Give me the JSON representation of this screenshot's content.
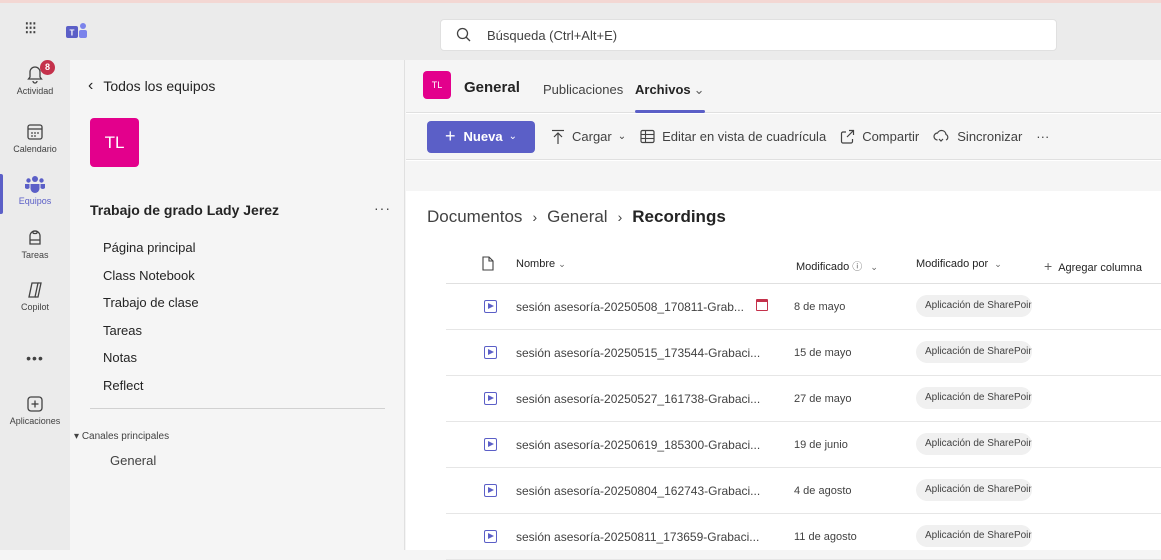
{
  "search": {
    "placeholder": "Búsqueda (Ctrl+Alt+E)"
  },
  "rail": {
    "items": [
      {
        "label": "Actividad",
        "icon": "bell-icon",
        "badge": "8"
      },
      {
        "label": "Calendario",
        "icon": "calendar-icon"
      },
      {
        "label": "Equipos",
        "icon": "teams-icon",
        "active": true
      },
      {
        "label": "Tareas",
        "icon": "tasks-icon"
      },
      {
        "label": "Copilot",
        "icon": "copilot-icon"
      },
      {
        "label": "•••",
        "icon": "more-icon"
      },
      {
        "label": "Aplicaciones",
        "icon": "apps-icon"
      }
    ]
  },
  "teams_pane": {
    "back_label": "Todos los equipos",
    "team_initials": "TL",
    "team_name": "Trabajo de grado Lady Jerez",
    "more": "···",
    "nav": [
      "Página principal",
      "Class Notebook",
      "Trabajo de clase",
      "Tareas",
      "Notas",
      "Reflect"
    ],
    "channels_header": "Canales principales",
    "channels": [
      "General"
    ]
  },
  "channel": {
    "initials": "TL",
    "title": "General",
    "tabs": [
      "Publicaciones",
      "Archivos"
    ]
  },
  "toolbar": {
    "new_label": "Nueva",
    "upload_label": "Cargar",
    "grid_label": "Editar en vista de cuadrícula",
    "share_label": "Compartir",
    "sync_label": "Sincronizar",
    "more": "···"
  },
  "breadcrumb": [
    "Documentos",
    "General",
    "Recordings"
  ],
  "table": {
    "headers": {
      "name": "Nombre",
      "modified": "Modificado",
      "modified_by": "Modificado por",
      "add_column": "Agregar columna"
    },
    "rows": [
      {
        "name": "sesión asesoría-20250508_170811-Grab...",
        "date": "8 de mayo",
        "by": "Aplicación de SharePoint",
        "calendar": true
      },
      {
        "name": "sesión asesoría-20250515_173544-Grabaci...",
        "date": "15 de mayo",
        "by": "Aplicación de SharePoint"
      },
      {
        "name": "sesión asesoría-20250527_161738-Grabaci...",
        "date": "27 de mayo",
        "by": "Aplicación de SharePoint"
      },
      {
        "name": "sesión asesoría-20250619_185300-Grabaci...",
        "date": "19 de junio",
        "by": "Aplicación de SharePoint"
      },
      {
        "name": "sesión asesoría-20250804_162743-Grabaci...",
        "date": "4 de agosto",
        "by": "Aplicación de SharePoint"
      },
      {
        "name": "sesión asesoría-20250811_173659-Grabaci...",
        "date": "11 de agosto",
        "by": "Aplicación de SharePoint"
      }
    ]
  },
  "colors": {
    "accent": "#5b5fc7",
    "team_avatar": "#e3008c",
    "badge": "#c4314b"
  }
}
